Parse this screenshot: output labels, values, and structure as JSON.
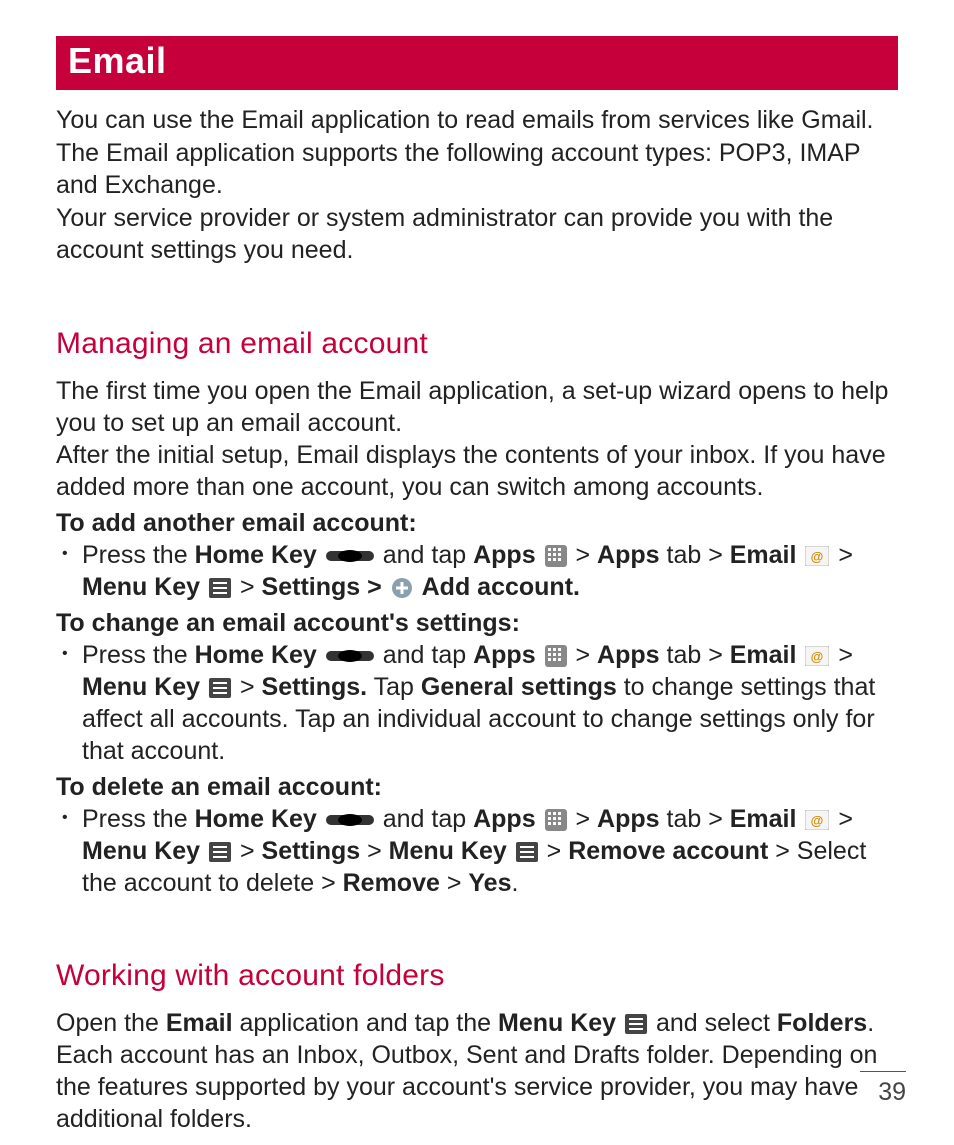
{
  "header": {
    "title": "Email"
  },
  "intro": {
    "p1": "You can use the Email application to read emails from services like Gmail. The Email application supports the following account types: POP3, IMAP and Exchange.",
    "p2": "Your service provider or system administrator can provide you with the account settings you need."
  },
  "section1": {
    "title": "Managing an email account",
    "p1": "The first time you open the Email application, a set-up wizard opens to help you to set up an email account.",
    "p2": "After the initial setup, Email displays the contents of your inbox. If you have added more than one account, you can switch among accounts.",
    "add": {
      "heading": "To add another email account:",
      "press_the": "Press the ",
      "home_key": "Home Key",
      "and_tap": " and tap ",
      "apps": "Apps",
      "apps_tab": "Apps",
      "tab_word": " tab",
      "email": "Email",
      "menu_key": "Menu Key",
      "settings": "Settings",
      "add_account": "Add account."
    },
    "change": {
      "heading": "To change an email account's settings:",
      "settings_period": "Settings.",
      "tap_word": " Tap ",
      "general_settings": "General settings",
      "tail": " to change settings that affect all accounts. Tap an individual account to change settings only for that account."
    },
    "del": {
      "heading": "To delete an email account:",
      "settings": "Settings",
      "menu_key2": "Menu Key",
      "remove_account": "Remove account",
      "select_text": " Select the account to delete ",
      "remove": "Remove",
      "yes": "Yes"
    }
  },
  "section2": {
    "title": "Working with account folders",
    "open_the": "Open the ",
    "email": "Email",
    "mid1": " application and tap the ",
    "menu_key": "Menu Key",
    "mid2": " and select ",
    "folders": "Folders",
    "tail": ". Each account has an Inbox, Outbox, Sent and Drafts folder. Depending on the features supported by your account's service provider, you may have additional folders."
  },
  "page_number": "39",
  "gt": " > "
}
